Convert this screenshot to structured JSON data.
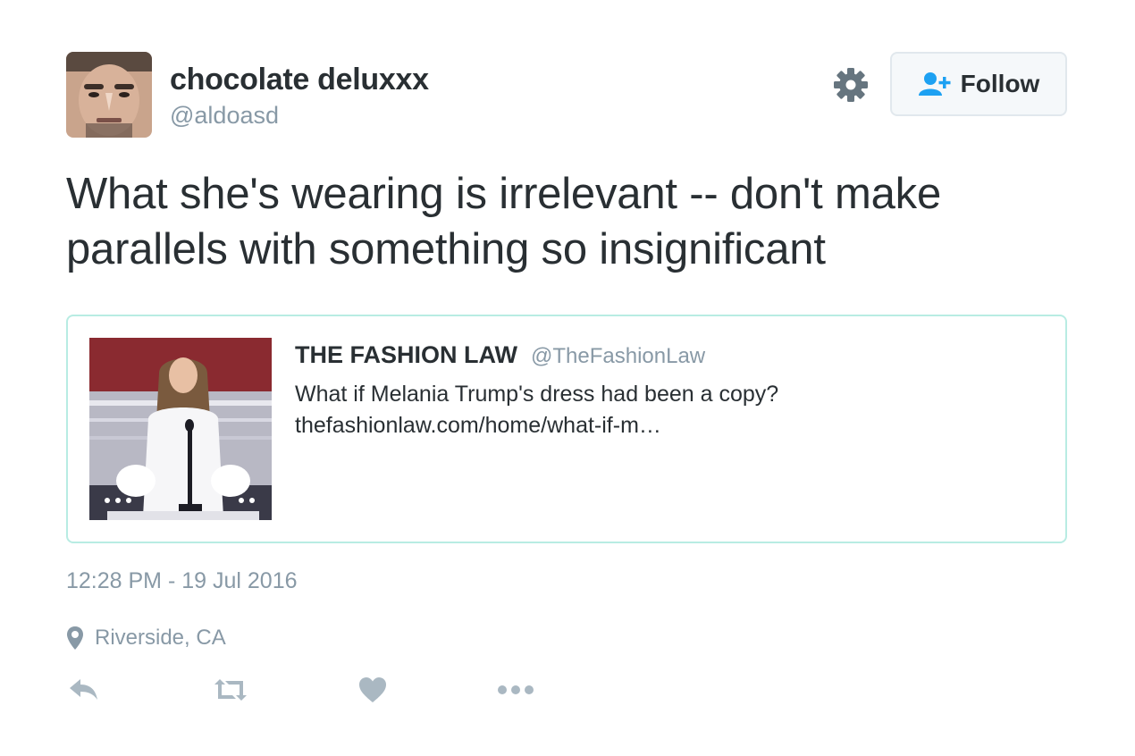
{
  "user": {
    "display_name": "chocolate deluxxx",
    "handle": "@aldoasd",
    "avatar_icon": "user-avatar-photo"
  },
  "header": {
    "settings_icon": "gear-icon",
    "follow_label": "Follow",
    "follow_icon": "add-user-icon"
  },
  "tweet": {
    "text": "What she's wearing is irrelevant -- don't make parallels with something so insignificant",
    "timestamp": "12:28 PM - 19 Jul 2016",
    "location": "Riverside, CA"
  },
  "quoted_tweet": {
    "author": "THE FASHION LAW",
    "handle": "@TheFashionLaw",
    "text_line1": "What if Melania Trump's dress had been a copy?",
    "text_line2": "thefashionlaw.com/home/what-if-m…",
    "image": "speaker-at-podium-photo"
  },
  "actions": [
    "reply-icon",
    "retweet-icon",
    "like-icon",
    "more-icon"
  ],
  "colors": {
    "text": "#292f33",
    "secondary": "#8899a6",
    "accent": "#1da1f2",
    "card_border": "#b8ece3",
    "icon": "#8899a6"
  }
}
